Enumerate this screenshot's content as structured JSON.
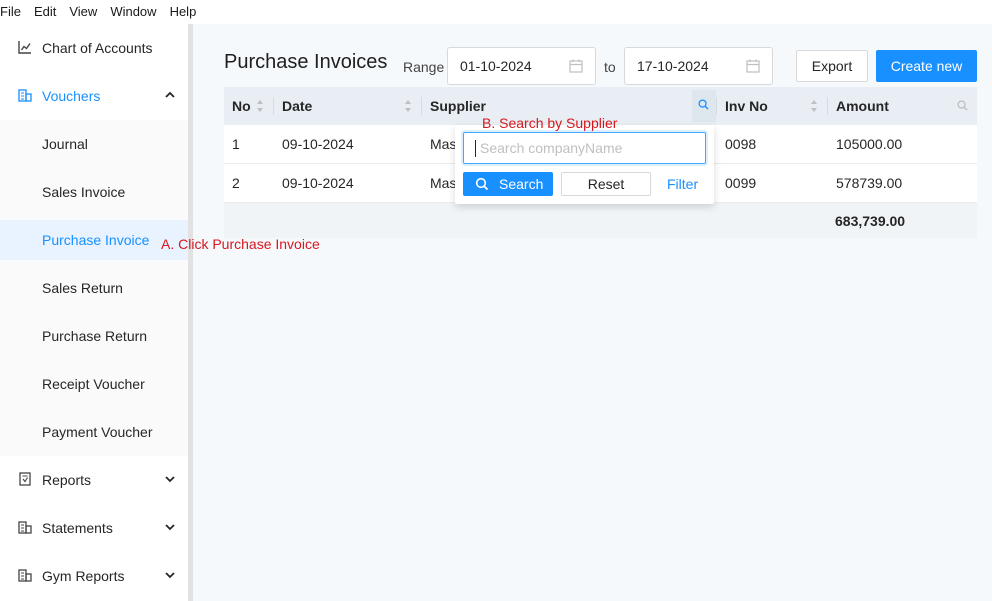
{
  "menubar": [
    "File",
    "Edit",
    "View",
    "Window",
    "Help"
  ],
  "sidebar": {
    "chart_of_accounts": "Chart of Accounts",
    "vouchers": "Vouchers",
    "submenu": [
      "Journal",
      "Sales Invoice",
      "Purchase Invoice",
      "Sales Return",
      "Purchase Return",
      "Receipt Voucher",
      "Payment Voucher"
    ],
    "reports": "Reports",
    "statements": "Statements",
    "gym_reports": "Gym Reports"
  },
  "header": {
    "title": "Purchase Invoices",
    "range_label": "Range",
    "date_from": "01-10-2024",
    "to_label": "to",
    "date_to": "17-10-2024",
    "export_label": "Export",
    "create_label": "Create new"
  },
  "table": {
    "columns": [
      "No",
      "Date",
      "Supplier",
      "Inv No",
      "Amount"
    ],
    "rows": [
      {
        "no": "1",
        "date": "09-10-2024",
        "supplier": "Mas",
        "inv_no": "0098",
        "amount": "105000.00"
      },
      {
        "no": "2",
        "date": "09-10-2024",
        "supplier": "Mas",
        "inv_no": "0099",
        "amount": "578739.00"
      }
    ],
    "total": "683,739.00"
  },
  "filter_dropdown": {
    "placeholder": "Search companyName",
    "search_label": "Search",
    "reset_label": "Reset",
    "filter_label": "Filter"
  },
  "annotations": {
    "a": "A. Click Purchase Invoice",
    "b": "B. Search by Supplier"
  },
  "colors": {
    "accent": "#1890ff",
    "annotation": "#d6181e",
    "active_bg": "#e8f3ff"
  }
}
